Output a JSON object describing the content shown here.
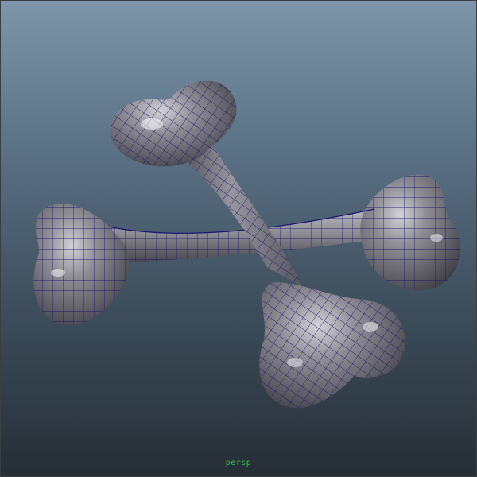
{
  "viewport": {
    "camera_label": "persp",
    "camera_label_color": "#2fbf4e"
  },
  "scene": {
    "objects": [
      {
        "name": "bone-horizontal",
        "shape": "bone",
        "surface_color": "#8f8d95",
        "wireframe_color": "#1a1570"
      },
      {
        "name": "bone-diagonal",
        "shape": "bone",
        "surface_color": "#8f8d95",
        "wireframe_color": "#1a1570"
      }
    ],
    "display_mode": "smooth-shade-with-wireframe"
  }
}
